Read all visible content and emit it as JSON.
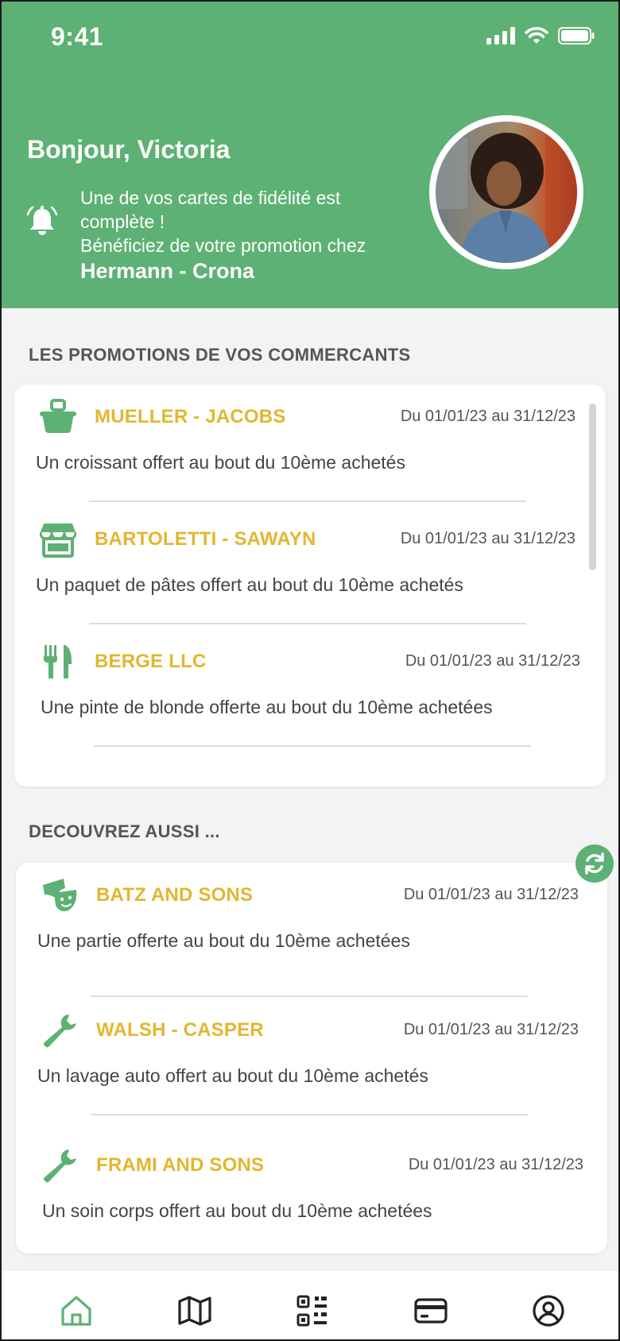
{
  "status_bar": {
    "time": "9:41"
  },
  "header": {
    "greeting": "Bonjour, Victoria",
    "notification": {
      "line1": "Une de vos cartes  de fidélité est",
      "line2": "complète !",
      "line3": "Bénéficiez de votre promotion chez",
      "merchant": "Hermann - Crona"
    }
  },
  "promotions": {
    "title": "LES PROMOTIONS DE VOS COMMERCANTS",
    "items": [
      {
        "icon": "basket-icon",
        "name": "MUELLER - JACOBS",
        "date": "Du 01/01/23 au 31/12/23",
        "description": "Un croissant offert au bout du 10ème achetés"
      },
      {
        "icon": "store-icon",
        "name": "BARTOLETTI - SAWAYN",
        "date": "Du 01/01/23 au 31/12/23",
        "description": "Un paquet de pâtes offert au bout du 10ème achetés"
      },
      {
        "icon": "fork-knife-icon",
        "name": "BERGE LLC",
        "date": "Du 01/01/23 au 31/12/23",
        "description": "Une pinte de blonde offerte au bout du 10ème achetées"
      }
    ]
  },
  "discover": {
    "title": "DECOUVREZ AUSSI ...",
    "items": [
      {
        "icon": "masks-icon",
        "name": "BATZ AND SONS",
        "date": "Du 01/01/23 au 31/12/23",
        "description": "Une partie offerte au bout du 10ème achetées"
      },
      {
        "icon": "wrench-icon",
        "name": "WALSH - CASPER",
        "date": "Du 01/01/23 au 31/12/23",
        "description": "Un lavage auto offert au bout du 10ème achetés"
      },
      {
        "icon": "wrench-icon",
        "name": "FRAMI AND SONS",
        "date": "Du 01/01/23 au 31/12/23",
        "description": "Un soin corps offert au bout du 10ème achetées"
      }
    ]
  },
  "tabbar": {
    "tabs": [
      "home-icon",
      "map-icon",
      "qr-code-icon",
      "card-icon",
      "account-icon"
    ],
    "active": "home-icon"
  },
  "colors": {
    "primary": "#5db174",
    "merchant_name": "#e2b62f",
    "background": "#f3f3f3"
  }
}
